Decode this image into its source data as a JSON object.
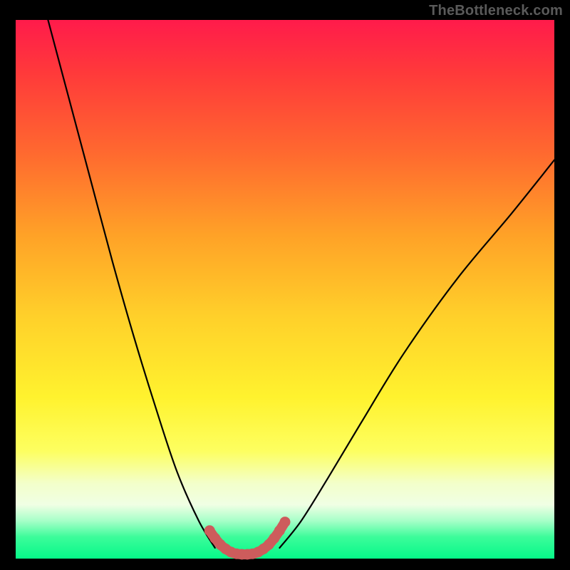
{
  "watermark": "TheBottleneck.com",
  "chart_data": {
    "type": "line",
    "title": "",
    "xlabel": "",
    "ylabel": "",
    "xlim": [
      0,
      100
    ],
    "ylim": [
      0,
      100
    ],
    "series": [
      {
        "name": "black-curve-left",
        "x": [
          6,
          10,
          14,
          18,
          22,
          26,
          30,
          34,
          37
        ],
        "y": [
          100,
          85,
          70,
          55,
          41,
          28,
          16,
          7,
          2
        ]
      },
      {
        "name": "black-curve-right",
        "x": [
          49,
          53,
          58,
          64,
          72,
          82,
          92,
          100
        ],
        "y": [
          2,
          7,
          15,
          25,
          38,
          52,
          64,
          74
        ]
      },
      {
        "name": "red-u-overlay",
        "x": [
          36,
          37,
          38,
          39,
          40,
          41,
          42,
          43,
          44,
          45,
          46,
          47,
          48,
          49,
          50
        ],
        "y": [
          5.2,
          3.8,
          2.6,
          1.8,
          1.2,
          0.9,
          0.8,
          0.8,
          0.9,
          1.2,
          1.8,
          2.6,
          3.8,
          5.2,
          6.8
        ]
      }
    ],
    "gradient_stops": [
      {
        "pos": 0,
        "color": "#ff1b4b"
      },
      {
        "pos": 10,
        "color": "#ff3a3a"
      },
      {
        "pos": 25,
        "color": "#ff6a2f"
      },
      {
        "pos": 40,
        "color": "#ffa227"
      },
      {
        "pos": 55,
        "color": "#ffd02a"
      },
      {
        "pos": 70,
        "color": "#fff22e"
      },
      {
        "pos": 80,
        "color": "#fdff60"
      },
      {
        "pos": 86,
        "color": "#f3ffca"
      },
      {
        "pos": 90,
        "color": "#f0ffe4"
      },
      {
        "pos": 93,
        "color": "#a6ffc8"
      },
      {
        "pos": 96,
        "color": "#3cfc9a"
      },
      {
        "pos": 100,
        "color": "#05f989"
      }
    ],
    "colors": {
      "curve": "#000000",
      "u_overlay": "#cd5c5c",
      "background_frame": "#000000"
    }
  }
}
